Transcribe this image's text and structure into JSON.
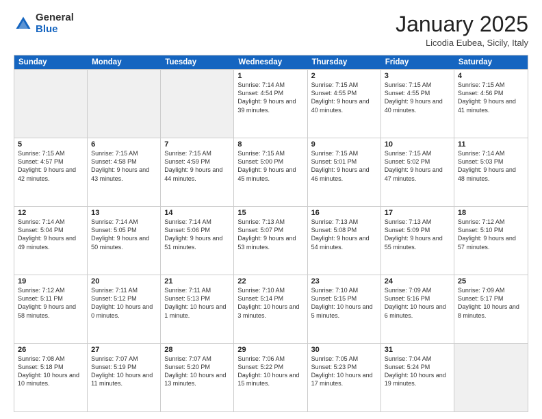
{
  "header": {
    "logo_general": "General",
    "logo_blue": "Blue",
    "month_title": "January 2025",
    "location": "Licodia Eubea, Sicily, Italy"
  },
  "days_of_week": [
    "Sunday",
    "Monday",
    "Tuesday",
    "Wednesday",
    "Thursday",
    "Friday",
    "Saturday"
  ],
  "weeks": [
    {
      "cells": [
        {
          "day": null,
          "shaded": true
        },
        {
          "day": null,
          "shaded": true
        },
        {
          "day": null,
          "shaded": true
        },
        {
          "day": "1",
          "sunrise": "7:14 AM",
          "sunset": "4:54 PM",
          "daylight": "9 hours and 39 minutes."
        },
        {
          "day": "2",
          "sunrise": "7:15 AM",
          "sunset": "4:55 PM",
          "daylight": "9 hours and 40 minutes."
        },
        {
          "day": "3",
          "sunrise": "7:15 AM",
          "sunset": "4:55 PM",
          "daylight": "9 hours and 40 minutes."
        },
        {
          "day": "4",
          "sunrise": "7:15 AM",
          "sunset": "4:56 PM",
          "daylight": "9 hours and 41 minutes."
        }
      ]
    },
    {
      "cells": [
        {
          "day": "5",
          "sunrise": "7:15 AM",
          "sunset": "4:57 PM",
          "daylight": "9 hours and 42 minutes."
        },
        {
          "day": "6",
          "sunrise": "7:15 AM",
          "sunset": "4:58 PM",
          "daylight": "9 hours and 43 minutes."
        },
        {
          "day": "7",
          "sunrise": "7:15 AM",
          "sunset": "4:59 PM",
          "daylight": "9 hours and 44 minutes."
        },
        {
          "day": "8",
          "sunrise": "7:15 AM",
          "sunset": "5:00 PM",
          "daylight": "9 hours and 45 minutes."
        },
        {
          "day": "9",
          "sunrise": "7:15 AM",
          "sunset": "5:01 PM",
          "daylight": "9 hours and 46 minutes."
        },
        {
          "day": "10",
          "sunrise": "7:15 AM",
          "sunset": "5:02 PM",
          "daylight": "9 hours and 47 minutes."
        },
        {
          "day": "11",
          "sunrise": "7:14 AM",
          "sunset": "5:03 PM",
          "daylight": "9 hours and 48 minutes."
        }
      ]
    },
    {
      "cells": [
        {
          "day": "12",
          "sunrise": "7:14 AM",
          "sunset": "5:04 PM",
          "daylight": "9 hours and 49 minutes."
        },
        {
          "day": "13",
          "sunrise": "7:14 AM",
          "sunset": "5:05 PM",
          "daylight": "9 hours and 50 minutes."
        },
        {
          "day": "14",
          "sunrise": "7:14 AM",
          "sunset": "5:06 PM",
          "daylight": "9 hours and 51 minutes."
        },
        {
          "day": "15",
          "sunrise": "7:13 AM",
          "sunset": "5:07 PM",
          "daylight": "9 hours and 53 minutes."
        },
        {
          "day": "16",
          "sunrise": "7:13 AM",
          "sunset": "5:08 PM",
          "daylight": "9 hours and 54 minutes."
        },
        {
          "day": "17",
          "sunrise": "7:13 AM",
          "sunset": "5:09 PM",
          "daylight": "9 hours and 55 minutes."
        },
        {
          "day": "18",
          "sunrise": "7:12 AM",
          "sunset": "5:10 PM",
          "daylight": "9 hours and 57 minutes."
        }
      ]
    },
    {
      "cells": [
        {
          "day": "19",
          "sunrise": "7:12 AM",
          "sunset": "5:11 PM",
          "daylight": "9 hours and 58 minutes."
        },
        {
          "day": "20",
          "sunrise": "7:11 AM",
          "sunset": "5:12 PM",
          "daylight": "10 hours and 0 minutes."
        },
        {
          "day": "21",
          "sunrise": "7:11 AM",
          "sunset": "5:13 PM",
          "daylight": "10 hours and 1 minute."
        },
        {
          "day": "22",
          "sunrise": "7:10 AM",
          "sunset": "5:14 PM",
          "daylight": "10 hours and 3 minutes."
        },
        {
          "day": "23",
          "sunrise": "7:10 AM",
          "sunset": "5:15 PM",
          "daylight": "10 hours and 5 minutes."
        },
        {
          "day": "24",
          "sunrise": "7:09 AM",
          "sunset": "5:16 PM",
          "daylight": "10 hours and 6 minutes."
        },
        {
          "day": "25",
          "sunrise": "7:09 AM",
          "sunset": "5:17 PM",
          "daylight": "10 hours and 8 minutes."
        }
      ]
    },
    {
      "cells": [
        {
          "day": "26",
          "sunrise": "7:08 AM",
          "sunset": "5:18 PM",
          "daylight": "10 hours and 10 minutes."
        },
        {
          "day": "27",
          "sunrise": "7:07 AM",
          "sunset": "5:19 PM",
          "daylight": "10 hours and 11 minutes."
        },
        {
          "day": "28",
          "sunrise": "7:07 AM",
          "sunset": "5:20 PM",
          "daylight": "10 hours and 13 minutes."
        },
        {
          "day": "29",
          "sunrise": "7:06 AM",
          "sunset": "5:22 PM",
          "daylight": "10 hours and 15 minutes."
        },
        {
          "day": "30",
          "sunrise": "7:05 AM",
          "sunset": "5:23 PM",
          "daylight": "10 hours and 17 minutes."
        },
        {
          "day": "31",
          "sunrise": "7:04 AM",
          "sunset": "5:24 PM",
          "daylight": "10 hours and 19 minutes."
        },
        {
          "day": null,
          "shaded": true
        }
      ]
    }
  ]
}
